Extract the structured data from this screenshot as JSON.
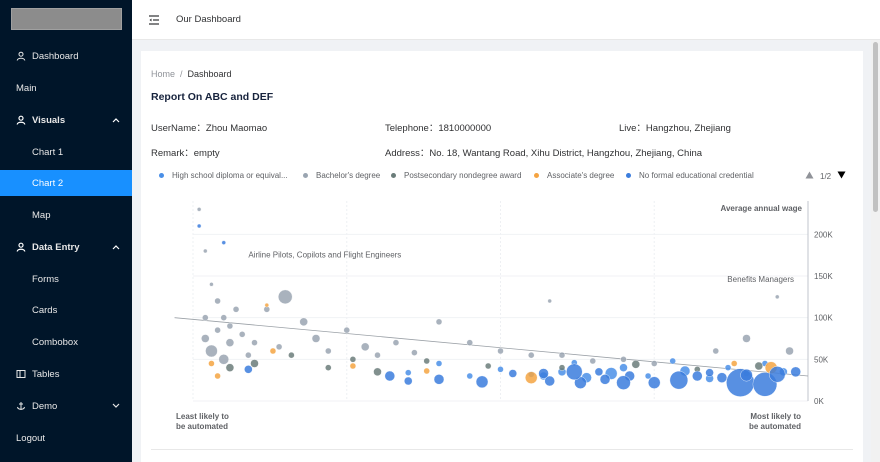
{
  "sidebar": {
    "items": [
      {
        "label": "Dashboard",
        "icon": "user-icon"
      },
      {
        "label": "Main"
      },
      {
        "label": "Visuals",
        "icon": "user-icon"
      },
      {
        "label": "Chart 1"
      },
      {
        "label": "Chart 2"
      },
      {
        "label": "Map"
      },
      {
        "label": "Data Entry",
        "icon": "user-icon"
      },
      {
        "label": "Forms"
      },
      {
        "label": "Cards"
      },
      {
        "label": "Combobox"
      },
      {
        "label": "Tables",
        "icon": "table-icon"
      },
      {
        "label": "Demo",
        "icon": "anchor-icon"
      },
      {
        "label": "Logout"
      }
    ],
    "colors": {
      "background": "#001529",
      "active": "#1890ff"
    }
  },
  "topbar": {
    "title": "Our Dashboard"
  },
  "breadcrumb": {
    "home": "Home",
    "separator": "/",
    "current": "Dashboard"
  },
  "report": {
    "title": "Report On ABC and DEF",
    "username": "UserName：Zhou Maomao",
    "telephone": "Telephone：1810000000",
    "live": "Live：Hangzhou, Zhejiang",
    "remark": "Remark：empty",
    "address": "Address：No. 18, Wantang Road, Xihu District, Hangzhou, Zhejiang, China"
  },
  "legend": {
    "items": [
      {
        "label": "High school diploma or equival...",
        "color": "#4a8fe7"
      },
      {
        "label": "Bachelor's degree",
        "color": "#9aa5b1"
      },
      {
        "label": "Postsecondary nondegree award",
        "color": "#6b7d7a"
      },
      {
        "label": "Associate's degree",
        "color": "#f5a442"
      },
      {
        "label": "No formal educational credential",
        "color": "#3b7ddd"
      }
    ],
    "page": "1/2"
  },
  "chart_data": {
    "type": "scatter",
    "title": "",
    "ylabel": "Average annual wage",
    "y_ticks": [
      "200K",
      "150K",
      "100K",
      "50K",
      "0K"
    ],
    "ylim": [
      0,
      240000
    ],
    "xlim": [
      0,
      1
    ],
    "x_left_label": [
      "Least likely to",
      "be automated"
    ],
    "x_right_label": [
      "Most likely to",
      "be automated"
    ],
    "annotations": [
      "Airline Pilots, Copilots and Flight Engineers",
      "Benefits Managers"
    ],
    "trend_line": [
      [
        -0.03,
        100000
      ],
      [
        1.0,
        30000
      ]
    ],
    "series": [
      {
        "name": "High school diploma or equival...",
        "color": "#4a8fe7",
        "points": [
          [
            0.55,
            32000,
            3
          ],
          [
            0.6,
            35000,
            4
          ],
          [
            0.64,
            28000,
            5
          ],
          [
            0.7,
            40000,
            4
          ],
          [
            0.74,
            30000,
            3
          ],
          [
            0.8,
            36000,
            5
          ],
          [
            0.84,
            27000,
            4
          ],
          [
            0.9,
            33000,
            3
          ],
          [
            0.93,
            45000,
            3
          ],
          [
            0.5,
            38000,
            3
          ],
          [
            0.45,
            30000,
            3
          ],
          [
            0.62,
            46000,
            3
          ],
          [
            0.78,
            48000,
            3
          ],
          [
            0.87,
            40000,
            3
          ],
          [
            0.96,
            35000,
            4
          ],
          [
            0.4,
            45000,
            3
          ],
          [
            0.35,
            34000,
            3
          ],
          [
            0.68,
            33000,
            6
          ],
          [
            0.57,
            30000,
            4
          ]
        ]
      },
      {
        "name": "Bachelor's degree",
        "color": "#9aa5b1",
        "points": [
          [
            0.01,
            230000,
            2
          ],
          [
            0.02,
            180000,
            2
          ],
          [
            0.03,
            140000,
            2
          ],
          [
            0.04,
            120000,
            3
          ],
          [
            0.05,
            100000,
            3
          ],
          [
            0.06,
            90000,
            3
          ],
          [
            0.08,
            80000,
            3
          ],
          [
            0.1,
            70000,
            3
          ],
          [
            0.12,
            110000,
            3
          ],
          [
            0.15,
            125000,
            7
          ],
          [
            0.18,
            95000,
            4
          ],
          [
            0.2,
            75000,
            4
          ],
          [
            0.22,
            60000,
            3
          ],
          [
            0.25,
            85000,
            3
          ],
          [
            0.28,
            65000,
            4
          ],
          [
            0.3,
            55000,
            3
          ],
          [
            0.33,
            70000,
            3
          ],
          [
            0.36,
            58000,
            3
          ],
          [
            0.03,
            60000,
            6
          ],
          [
            0.05,
            50000,
            5
          ],
          [
            0.02,
            75000,
            4
          ],
          [
            0.07,
            110000,
            3
          ],
          [
            0.09,
            55000,
            3
          ],
          [
            0.14,
            65000,
            3
          ],
          [
            0.4,
            95000,
            3
          ],
          [
            0.45,
            70000,
            3
          ],
          [
            0.5,
            60000,
            3
          ],
          [
            0.6,
            55000,
            3
          ],
          [
            0.7,
            50000,
            3
          ],
          [
            0.9,
            75000,
            4
          ],
          [
            0.97,
            60000,
            4
          ],
          [
            0.85,
            60000,
            3
          ],
          [
            0.75,
            45000,
            3
          ],
          [
            0.65,
            48000,
            3
          ],
          [
            0.55,
            55000,
            3
          ],
          [
            0.02,
            100000,
            3
          ],
          [
            0.04,
            85000,
            3
          ],
          [
            0.06,
            70000,
            4
          ],
          [
            0.95,
            125000,
            2
          ],
          [
            0.58,
            120000,
            2
          ]
        ]
      },
      {
        "name": "Postsecondary nondegree award",
        "color": "#6b7d7a",
        "points": [
          [
            0.06,
            40000,
            4
          ],
          [
            0.1,
            45000,
            4
          ],
          [
            0.16,
            55000,
            3
          ],
          [
            0.22,
            40000,
            3
          ],
          [
            0.3,
            35000,
            4
          ],
          [
            0.38,
            48000,
            3
          ],
          [
            0.48,
            42000,
            3
          ],
          [
            0.6,
            40000,
            3
          ],
          [
            0.72,
            44000,
            4
          ],
          [
            0.82,
            38000,
            3
          ],
          [
            0.92,
            42000,
            4
          ],
          [
            0.26,
            50000,
            3
          ]
        ]
      },
      {
        "name": "Associate's degree",
        "color": "#f5a442",
        "points": [
          [
            0.04,
            30000,
            3
          ],
          [
            0.13,
            60000,
            3
          ],
          [
            0.26,
            42000,
            3
          ],
          [
            0.38,
            36000,
            3
          ],
          [
            0.55,
            28000,
            6
          ],
          [
            0.88,
            45000,
            3
          ],
          [
            0.94,
            40000,
            6
          ],
          [
            0.03,
            45000,
            3
          ],
          [
            0.12,
            115000,
            2
          ]
        ]
      },
      {
        "name": "No formal educational credential",
        "color": "#3b7ddd",
        "points": [
          [
            0.01,
            210000,
            2
          ],
          [
            0.05,
            190000,
            2
          ],
          [
            0.09,
            38000,
            4
          ],
          [
            0.32,
            30000,
            5
          ],
          [
            0.4,
            26000,
            5
          ],
          [
            0.52,
            33000,
            4
          ],
          [
            0.63,
            22000,
            6
          ],
          [
            0.71,
            30000,
            5
          ],
          [
            0.79,
            25000,
            9
          ],
          [
            0.86,
            28000,
            5
          ],
          [
            0.89,
            22000,
            14
          ],
          [
            0.93,
            20000,
            12
          ],
          [
            0.95,
            32000,
            8
          ],
          [
            0.98,
            35000,
            5
          ],
          [
            0.82,
            30000,
            5
          ],
          [
            0.67,
            26000,
            5
          ],
          [
            0.58,
            24000,
            5
          ],
          [
            0.47,
            23000,
            6
          ],
          [
            0.35,
            24000,
            4
          ],
          [
            0.75,
            22000,
            6
          ],
          [
            0.62,
            35000,
            8
          ],
          [
            0.7,
            22000,
            7
          ],
          [
            0.9,
            31000,
            6
          ],
          [
            0.84,
            34000,
            4
          ],
          [
            0.57,
            33000,
            5
          ],
          [
            0.66,
            35000,
            4
          ]
        ]
      }
    ]
  }
}
